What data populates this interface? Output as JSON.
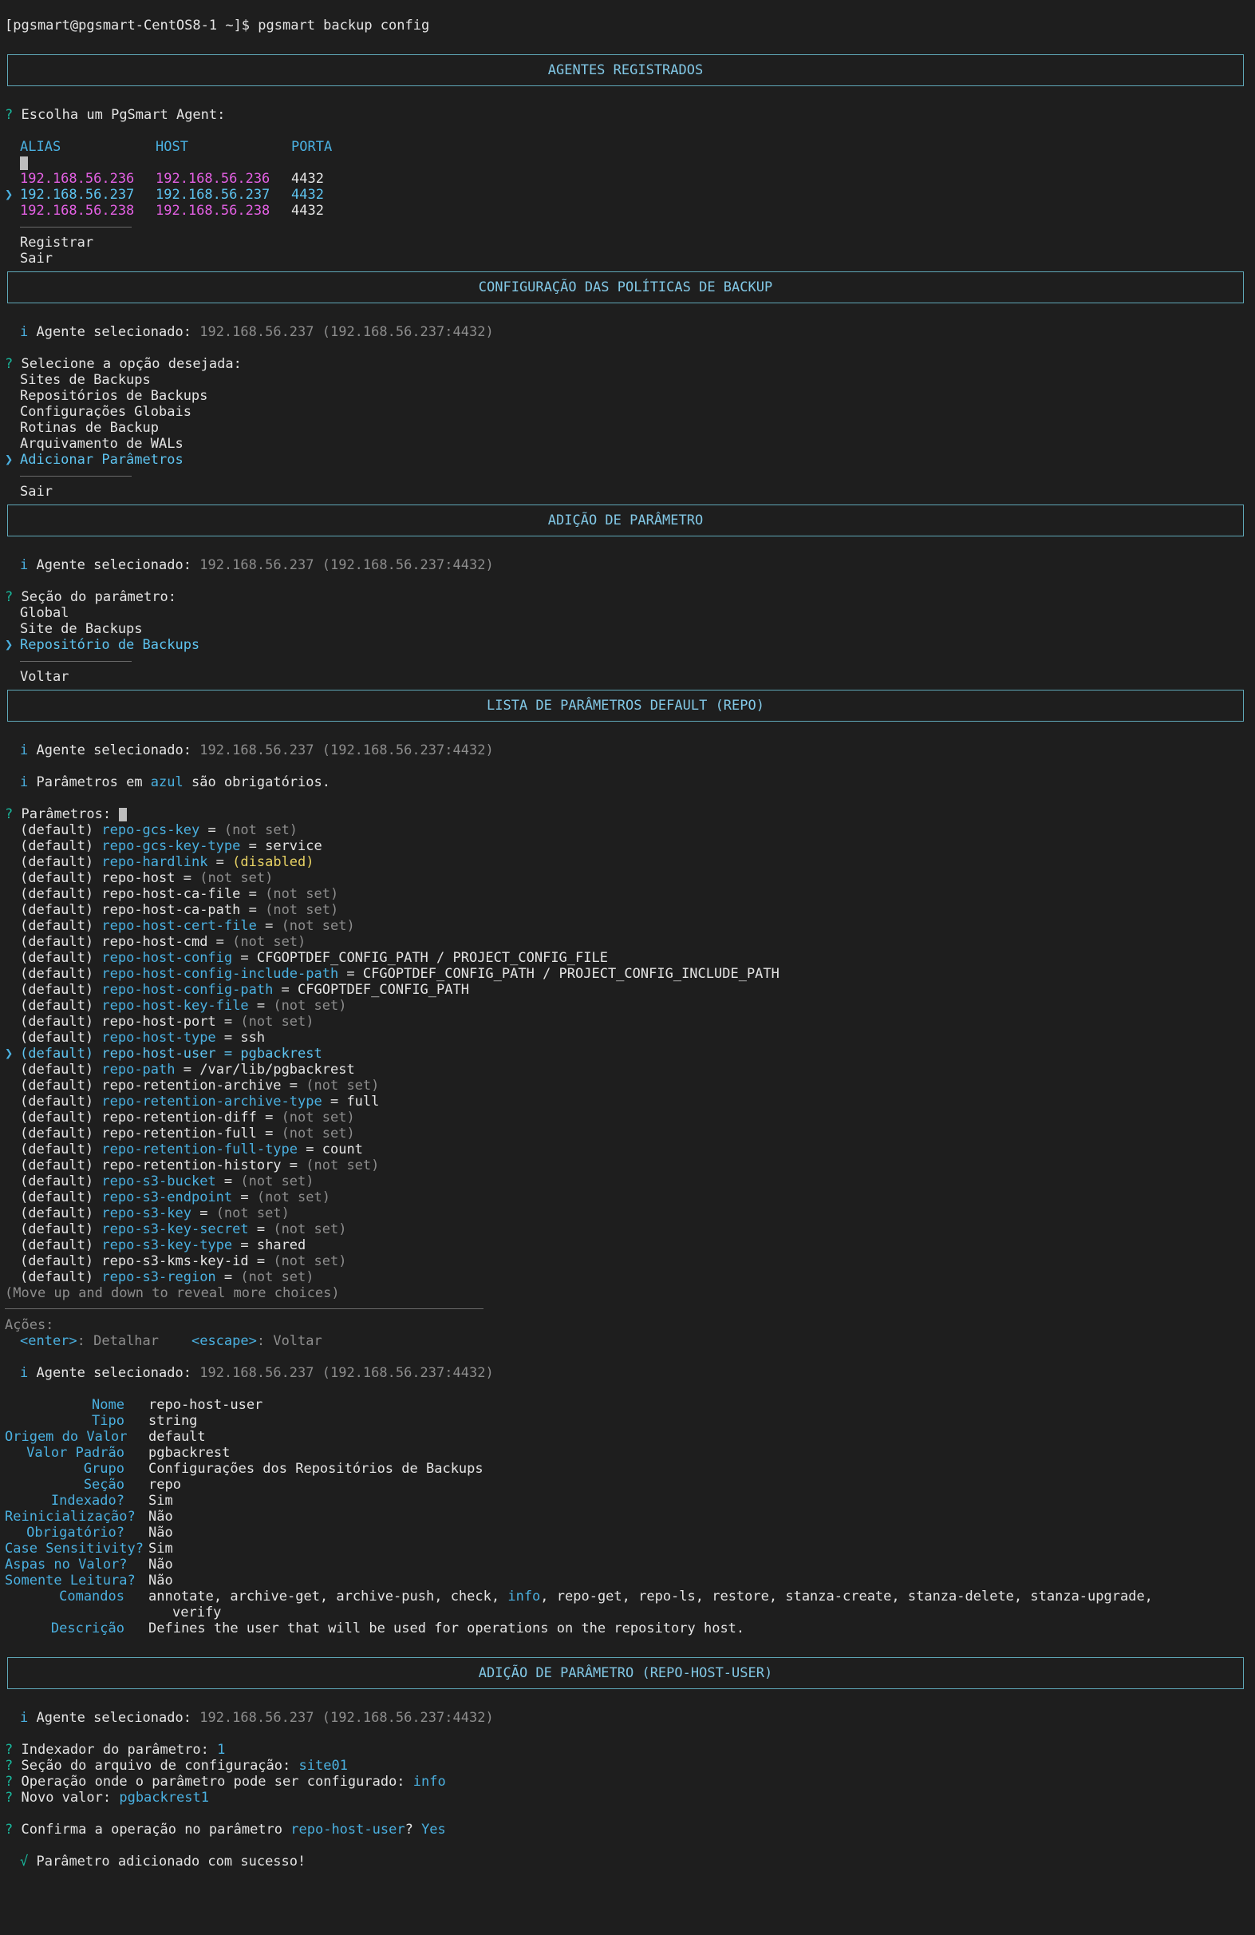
{
  "prompt": "[pgsmart@pgsmart-CentOS8-1 ~]$ pgsmart backup config",
  "box1": "AGENTES REGISTRADOS",
  "choose_agent": "Escolha um PgSmart Agent:",
  "agent_cols": {
    "alias": "ALIAS",
    "host": "HOST",
    "porta": "PORTA"
  },
  "agents": [
    {
      "alias": "192.168.56.236",
      "host": "192.168.56.236",
      "port": "4432"
    },
    {
      "alias": "192.168.56.237",
      "host": "192.168.56.237",
      "port": "4432"
    },
    {
      "alias": "192.168.56.238",
      "host": "192.168.56.238",
      "port": "4432"
    }
  ],
  "agent_menu": {
    "register": "Registrar",
    "exit": "Sair"
  },
  "box2": "CONFIGURAÇÃO DAS POLÍTICAS DE BACKUP",
  "agent_label": "Agente selecionado:",
  "agent_value": "192.168.56.237 (192.168.56.237:4432)",
  "select_option": "Selecione a opção desejada:",
  "options": [
    "Sites de Backups",
    "Repositórios de Backups",
    "Configurações Globais",
    "Rotinas de Backup",
    "Arquivamento de WALs",
    "Adicionar Parâmetros"
  ],
  "options_exit": "Sair",
  "box3": "ADIÇÃO DE PARÂMETRO",
  "section_prompt": "Seção do parâmetro:",
  "sections": [
    "Global",
    "Site de Backups",
    "Repositório de Backups"
  ],
  "sections_back": "Voltar",
  "box4": "LISTA DE PARÂMETROS DEFAULT (REPO)",
  "note": {
    "pre": "Parâmetros em ",
    "word": "azul",
    "post": " são obrigatórios."
  },
  "params_prompt": "Parâmetros:",
  "params": [
    {
      "name": "repo-gcs-key",
      "value": "(not set)",
      "req": true,
      "vclass": "dim"
    },
    {
      "name": "repo-gcs-key-type",
      "value": "service",
      "req": true,
      "vclass": ""
    },
    {
      "name": "repo-hardlink",
      "value": "(disabled)",
      "req": true,
      "vclass": "yel"
    },
    {
      "name": "repo-host",
      "value": "(not set)",
      "req": false,
      "vclass": "dim"
    },
    {
      "name": "repo-host-ca-file",
      "value": "(not set)",
      "req": false,
      "vclass": "dim"
    },
    {
      "name": "repo-host-ca-path",
      "value": "(not set)",
      "req": false,
      "vclass": "dim"
    },
    {
      "name": "repo-host-cert-file",
      "value": "(not set)",
      "req": true,
      "vclass": "dim"
    },
    {
      "name": "repo-host-cmd",
      "value": "(not set)",
      "req": false,
      "vclass": "dim"
    },
    {
      "name": "repo-host-config",
      "value": "CFGOPTDEF_CONFIG_PATH / PROJECT_CONFIG_FILE",
      "req": true,
      "vclass": ""
    },
    {
      "name": "repo-host-config-include-path",
      "value": "CFGOPTDEF_CONFIG_PATH / PROJECT_CONFIG_INCLUDE_PATH",
      "req": true,
      "vclass": ""
    },
    {
      "name": "repo-host-config-path",
      "value": "CFGOPTDEF_CONFIG_PATH",
      "req": true,
      "vclass": ""
    },
    {
      "name": "repo-host-key-file",
      "value": "(not set)",
      "req": true,
      "vclass": "dim"
    },
    {
      "name": "repo-host-port",
      "value": "(not set)",
      "req": false,
      "vclass": "dim"
    },
    {
      "name": "repo-host-type",
      "value": "ssh",
      "req": true,
      "vclass": ""
    },
    {
      "name": "repo-host-user",
      "value": "pgbackrest",
      "req": false,
      "vclass": "",
      "selected": true
    },
    {
      "name": "repo-path",
      "value": "/var/lib/pgbackrest",
      "req": true,
      "vclass": ""
    },
    {
      "name": "repo-retention-archive",
      "value": "(not set)",
      "req": false,
      "vclass": "dim"
    },
    {
      "name": "repo-retention-archive-type",
      "value": "full",
      "req": true,
      "vclass": ""
    },
    {
      "name": "repo-retention-diff",
      "value": "(not set)",
      "req": false,
      "vclass": "dim"
    },
    {
      "name": "repo-retention-full",
      "value": "(not set)",
      "req": false,
      "vclass": "dim"
    },
    {
      "name": "repo-retention-full-type",
      "value": "count",
      "req": true,
      "vclass": ""
    },
    {
      "name": "repo-retention-history",
      "value": "(not set)",
      "req": false,
      "vclass": "dim"
    },
    {
      "name": "repo-s3-bucket",
      "value": "(not set)",
      "req": true,
      "vclass": "dim"
    },
    {
      "name": "repo-s3-endpoint",
      "value": "(not set)",
      "req": true,
      "vclass": "dim"
    },
    {
      "name": "repo-s3-key",
      "value": "(not set)",
      "req": true,
      "vclass": "dim"
    },
    {
      "name": "repo-s3-key-secret",
      "value": "(not set)",
      "req": true,
      "vclass": "dim"
    },
    {
      "name": "repo-s3-key-type",
      "value": "shared",
      "req": true,
      "vclass": ""
    },
    {
      "name": "repo-s3-kms-key-id",
      "value": "(not set)",
      "req": false,
      "vclass": "dim"
    },
    {
      "name": "repo-s3-region",
      "value": "(not set)",
      "req": true,
      "vclass": "dim"
    }
  ],
  "default_tag": "(default)",
  "more_choices": "(Move up and down to reveal more choices)",
  "actions_title": "Ações:",
  "actions": [
    {
      "key": "<enter>",
      "desc": ": Detalhar"
    },
    {
      "key": "<escape>",
      "desc": ": Voltar"
    }
  ],
  "details": [
    {
      "label": "Nome",
      "value": "repo-host-user"
    },
    {
      "label": "Tipo",
      "value": "string"
    },
    {
      "label": "Origem do Valor",
      "value": "default"
    },
    {
      "label": "Valor Padrão",
      "value": "pgbackrest"
    },
    {
      "label": "Grupo",
      "value": "Configurações dos Repositórios de Backups"
    },
    {
      "label": "Seção",
      "value": "repo"
    },
    {
      "label": "Indexado?",
      "value": "Sim"
    },
    {
      "label": "Reinicialização?",
      "value": "Não"
    },
    {
      "label": "Obrigatório?",
      "value": "Não"
    },
    {
      "label": "Case Sensitivity?",
      "value": "Sim"
    },
    {
      "label": "Aspas no Valor?",
      "value": "Não"
    },
    {
      "label": "Somente Leitura?",
      "value": "Não"
    }
  ],
  "commands_label": "Comandos",
  "commands_pre": "annotate, archive-get, archive-push, check, ",
  "commands_info": "info",
  "commands_post": ", repo-get, repo-ls, restore, stanza-create, stanza-delete, stanza-upgrade,",
  "commands_line2": "verify",
  "desc_label": "Descrição",
  "desc_value": "Defines the user that will be used for operations on the repository host.",
  "box5": "ADIÇÃO DE PARÂMETRO (REPO-HOST-USER)",
  "final_q": [
    {
      "label": "Indexador do parâmetro:",
      "value": "1"
    },
    {
      "label": "Seção do arquivo de configuração:",
      "value": "site01"
    },
    {
      "label": "Operação onde o parâmetro pode ser configurado:",
      "value": "info"
    },
    {
      "label": "Novo valor:",
      "value": "pgbackrest1"
    }
  ],
  "confirm_pre": "Confirma a operação no parâmetro ",
  "confirm_param": "repo-host-user",
  "confirm_post": "?",
  "confirm_answer": "Yes",
  "success": "Parâmetro adicionado com sucesso!",
  "symbols": {
    "question": "?",
    "info": "i",
    "pointer": "❯",
    "check": "√"
  }
}
